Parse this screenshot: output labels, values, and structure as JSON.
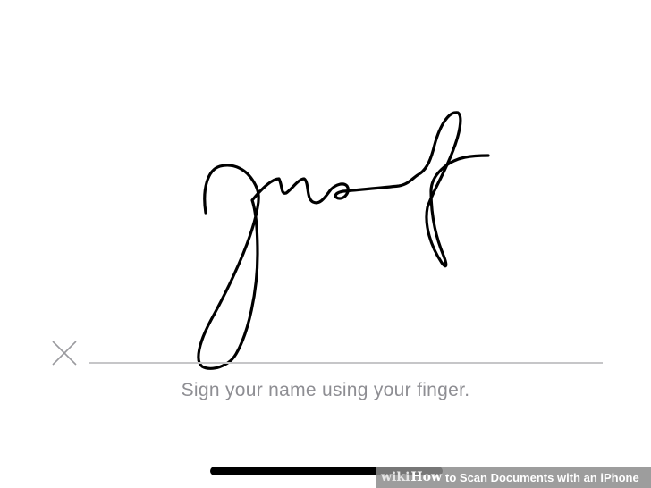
{
  "signature_pad": {
    "clear_icon": "x-icon",
    "hint_text": "Sign your name using your finger.",
    "stroke_color": "#000000",
    "baseline_color": "#c6c6c8",
    "hint_color": "#8e8e93"
  },
  "home_indicator": {
    "color": "#000000"
  },
  "watermark": {
    "brand_wiki": "wiki",
    "brand_how": "How",
    "title": "to Scan Documents with an iPhone"
  }
}
